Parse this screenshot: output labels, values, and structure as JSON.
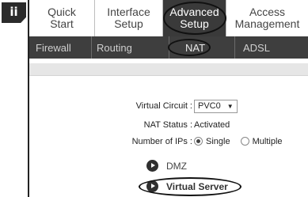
{
  "step_badge": "ii",
  "menu": {
    "items": [
      {
        "label": "Quick\nStart"
      },
      {
        "label": "Interface\nSetup"
      },
      {
        "label": "Advanced\nSetup"
      },
      {
        "label": "Access\nManagement"
      }
    ],
    "active_index": 2
  },
  "submenu": {
    "items": [
      {
        "label": "Firewall"
      },
      {
        "label": "Routing"
      },
      {
        "label": "NAT"
      },
      {
        "label": "ADSL"
      }
    ],
    "active_index": 2
  },
  "form": {
    "virtual_circuit": {
      "label": "Virtual Circuit :",
      "value": "PVC0"
    },
    "nat_status": {
      "label": "NAT Status :",
      "value": "Activated"
    },
    "number_of_ips": {
      "label": "Number of IPs :",
      "options": [
        "Single",
        "Multiple"
      ],
      "selected": "Single"
    }
  },
  "links": {
    "dmz": "DMZ",
    "virtual_server": "Virtual Server"
  },
  "colors": {
    "menu_active_bg": "#3a3a3a",
    "submenu_bg": "#3e3e3e",
    "annotation": "#111111"
  }
}
